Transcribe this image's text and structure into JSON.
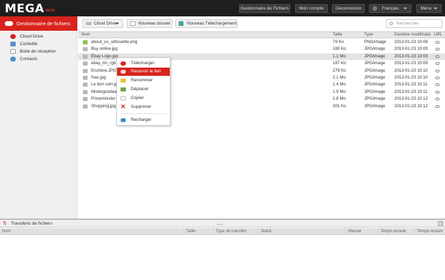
{
  "app": {
    "logo": "MEGA",
    "beta": "BETA"
  },
  "topbar": {
    "file_manager": "Gestionnaire de Fichiers",
    "account": "Mon compte",
    "logout": "Déconnexion",
    "language": "Français",
    "menu": "Menu"
  },
  "sidebar": {
    "header": "Gestionnaire de fichiers",
    "items": [
      {
        "label": "Cloud Drive",
        "icon": "cloud-icon"
      },
      {
        "label": "Corbeille",
        "icon": "trash-icon"
      },
      {
        "label": "Boite de réception",
        "icon": "inbox-icon"
      },
      {
        "label": "Contacts",
        "icon": "contacts-icon"
      }
    ]
  },
  "toolbar": {
    "cloud_drive": "Cloud Drive",
    "new_folder": "Nouveau dossier",
    "new_download": "Nouveau Téléchargement",
    "search_placeholder": "Rechercher"
  },
  "table": {
    "headers": {
      "name": "Nom",
      "size": "Taille",
      "type": "Type",
      "modified": "Dernière modificatio",
      "url": "URL"
    },
    "rows": [
      {
        "name": "about_us_silhouette.png",
        "size": "79 Ko",
        "type": "PNG/image",
        "date": "2013-01-23 10:08",
        "selected": false
      },
      {
        "name": "Buy online.jpg",
        "size": "180 Ko",
        "type": "JPG/image",
        "date": "2013-01-23 10:09",
        "selected": false
      },
      {
        "name": "Ebay Logo.jpg",
        "size": "1.1 Mo",
        "type": "JPG/image",
        "date": "2013-01-23 10:09",
        "selected": true
      },
      {
        "name": "ebay_tm_rgb",
        "size": "187 Ko",
        "type": "JPG/image",
        "date": "2013-01-23 10:09",
        "selected": false
      },
      {
        "name": "Enchère.JPG",
        "size": "279 Ko",
        "type": "JPG/image",
        "date": "2013-01-23 10:10",
        "selected": false
      },
      {
        "name": "fnac.jpg",
        "size": "2.1 Mo",
        "type": "JPG/image",
        "date": "2013-01-23 10:10",
        "selected": false
      },
      {
        "name": "Le bon coin.jp",
        "size": "1.4 Mo",
        "type": "JPG/image",
        "date": "2013-01-23 10:11",
        "selected": false
      },
      {
        "name": "Mistergoodea",
        "size": "1.9 Mo",
        "type": "JPG/image",
        "date": "2013-01-23 10:11",
        "selected": false
      },
      {
        "name": "Priceminister",
        "size": "1.8 Mo",
        "type": "JPG/image",
        "date": "2013-01-23 10:12",
        "selected": false
      },
      {
        "name": "Shopping.jpg",
        "size": "301 Ko",
        "type": "JPG/image",
        "date": "2013-01-23 10:12",
        "selected": false
      }
    ]
  },
  "context_menu": {
    "items": [
      {
        "label": "Télécharger",
        "icon": "download-cloud-icon",
        "highlight": false
      },
      {
        "label": "Recevoir le lien",
        "icon": "link-icon",
        "highlight": true
      },
      {
        "label": "Renommer",
        "icon": "rename-folder-icon",
        "highlight": false
      },
      {
        "label": "Déplacer",
        "icon": "move-arrow-icon",
        "highlight": false
      },
      {
        "label": "Copier",
        "icon": "copy-icon",
        "highlight": false
      },
      {
        "label": "Supprimer",
        "icon": "delete-x-icon",
        "highlight": false
      },
      {
        "label": "Recharger",
        "icon": "reload-icon",
        "highlight": false
      }
    ]
  },
  "transfers": {
    "title": "Transferts de fichiers",
    "columns": {
      "name": "Nom",
      "size": "Taille",
      "type": "Type de transfert",
      "status": "Statut",
      "speed": "Vitesse",
      "elapsed": "Temps écoulé",
      "remaining": "Temps restant"
    }
  },
  "colors": {
    "accent": "#d8231d",
    "topbar": "#1e1e1e"
  }
}
